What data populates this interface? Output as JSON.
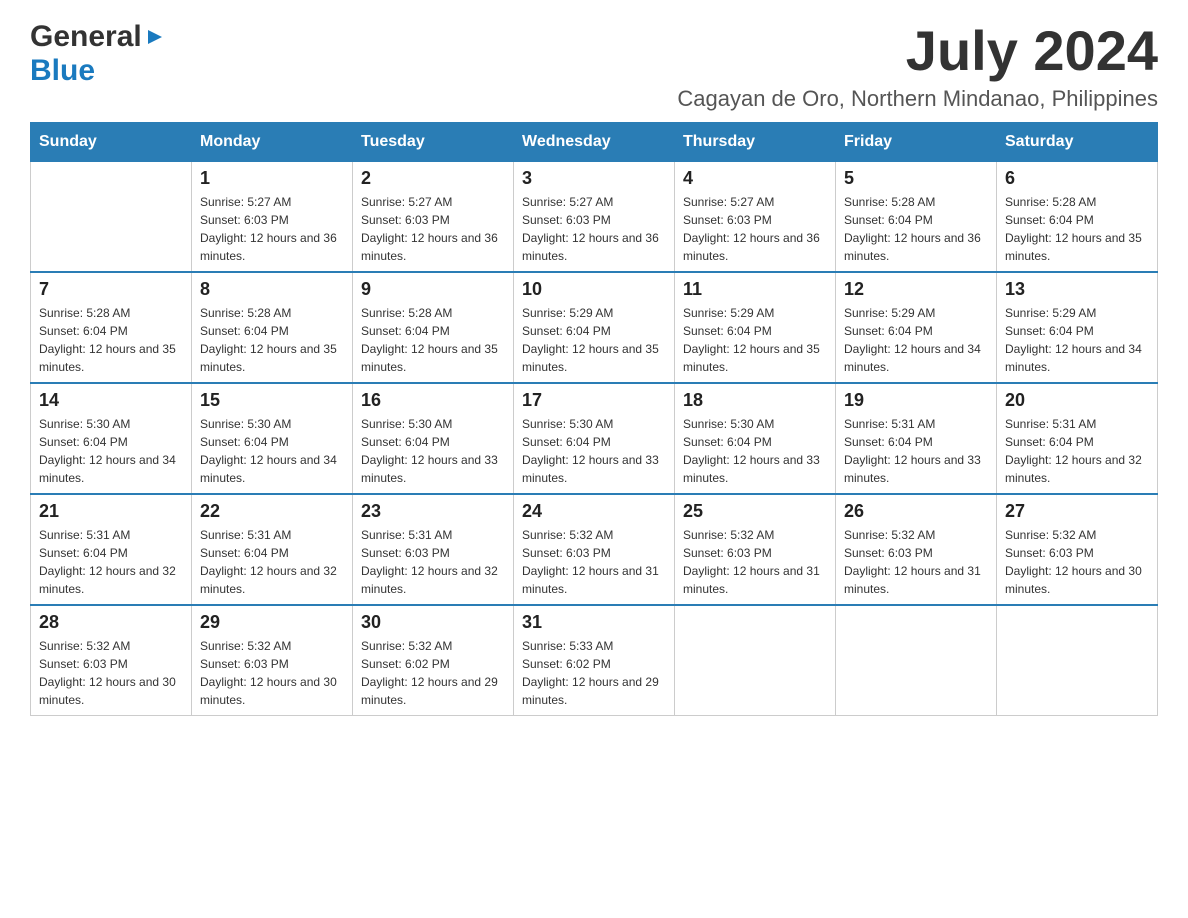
{
  "header": {
    "logo_general": "General",
    "logo_blue": "Blue",
    "month_title": "July 2024",
    "location": "Cagayan de Oro, Northern Mindanao, Philippines"
  },
  "days_of_week": [
    "Sunday",
    "Monday",
    "Tuesday",
    "Wednesday",
    "Thursday",
    "Friday",
    "Saturday"
  ],
  "weeks": [
    [
      {
        "day": "",
        "sunrise": "",
        "sunset": "",
        "daylight": ""
      },
      {
        "day": "1",
        "sunrise": "Sunrise: 5:27 AM",
        "sunset": "Sunset: 6:03 PM",
        "daylight": "Daylight: 12 hours and 36 minutes."
      },
      {
        "day": "2",
        "sunrise": "Sunrise: 5:27 AM",
        "sunset": "Sunset: 6:03 PM",
        "daylight": "Daylight: 12 hours and 36 minutes."
      },
      {
        "day": "3",
        "sunrise": "Sunrise: 5:27 AM",
        "sunset": "Sunset: 6:03 PM",
        "daylight": "Daylight: 12 hours and 36 minutes."
      },
      {
        "day": "4",
        "sunrise": "Sunrise: 5:27 AM",
        "sunset": "Sunset: 6:03 PM",
        "daylight": "Daylight: 12 hours and 36 minutes."
      },
      {
        "day": "5",
        "sunrise": "Sunrise: 5:28 AM",
        "sunset": "Sunset: 6:04 PM",
        "daylight": "Daylight: 12 hours and 36 minutes."
      },
      {
        "day": "6",
        "sunrise": "Sunrise: 5:28 AM",
        "sunset": "Sunset: 6:04 PM",
        "daylight": "Daylight: 12 hours and 35 minutes."
      }
    ],
    [
      {
        "day": "7",
        "sunrise": "Sunrise: 5:28 AM",
        "sunset": "Sunset: 6:04 PM",
        "daylight": "Daylight: 12 hours and 35 minutes."
      },
      {
        "day": "8",
        "sunrise": "Sunrise: 5:28 AM",
        "sunset": "Sunset: 6:04 PM",
        "daylight": "Daylight: 12 hours and 35 minutes."
      },
      {
        "day": "9",
        "sunrise": "Sunrise: 5:28 AM",
        "sunset": "Sunset: 6:04 PM",
        "daylight": "Daylight: 12 hours and 35 minutes."
      },
      {
        "day": "10",
        "sunrise": "Sunrise: 5:29 AM",
        "sunset": "Sunset: 6:04 PM",
        "daylight": "Daylight: 12 hours and 35 minutes."
      },
      {
        "day": "11",
        "sunrise": "Sunrise: 5:29 AM",
        "sunset": "Sunset: 6:04 PM",
        "daylight": "Daylight: 12 hours and 35 minutes."
      },
      {
        "day": "12",
        "sunrise": "Sunrise: 5:29 AM",
        "sunset": "Sunset: 6:04 PM",
        "daylight": "Daylight: 12 hours and 34 minutes."
      },
      {
        "day": "13",
        "sunrise": "Sunrise: 5:29 AM",
        "sunset": "Sunset: 6:04 PM",
        "daylight": "Daylight: 12 hours and 34 minutes."
      }
    ],
    [
      {
        "day": "14",
        "sunrise": "Sunrise: 5:30 AM",
        "sunset": "Sunset: 6:04 PM",
        "daylight": "Daylight: 12 hours and 34 minutes."
      },
      {
        "day": "15",
        "sunrise": "Sunrise: 5:30 AM",
        "sunset": "Sunset: 6:04 PM",
        "daylight": "Daylight: 12 hours and 34 minutes."
      },
      {
        "day": "16",
        "sunrise": "Sunrise: 5:30 AM",
        "sunset": "Sunset: 6:04 PM",
        "daylight": "Daylight: 12 hours and 33 minutes."
      },
      {
        "day": "17",
        "sunrise": "Sunrise: 5:30 AM",
        "sunset": "Sunset: 6:04 PM",
        "daylight": "Daylight: 12 hours and 33 minutes."
      },
      {
        "day": "18",
        "sunrise": "Sunrise: 5:30 AM",
        "sunset": "Sunset: 6:04 PM",
        "daylight": "Daylight: 12 hours and 33 minutes."
      },
      {
        "day": "19",
        "sunrise": "Sunrise: 5:31 AM",
        "sunset": "Sunset: 6:04 PM",
        "daylight": "Daylight: 12 hours and 33 minutes."
      },
      {
        "day": "20",
        "sunrise": "Sunrise: 5:31 AM",
        "sunset": "Sunset: 6:04 PM",
        "daylight": "Daylight: 12 hours and 32 minutes."
      }
    ],
    [
      {
        "day": "21",
        "sunrise": "Sunrise: 5:31 AM",
        "sunset": "Sunset: 6:04 PM",
        "daylight": "Daylight: 12 hours and 32 minutes."
      },
      {
        "day": "22",
        "sunrise": "Sunrise: 5:31 AM",
        "sunset": "Sunset: 6:04 PM",
        "daylight": "Daylight: 12 hours and 32 minutes."
      },
      {
        "day": "23",
        "sunrise": "Sunrise: 5:31 AM",
        "sunset": "Sunset: 6:03 PM",
        "daylight": "Daylight: 12 hours and 32 minutes."
      },
      {
        "day": "24",
        "sunrise": "Sunrise: 5:32 AM",
        "sunset": "Sunset: 6:03 PM",
        "daylight": "Daylight: 12 hours and 31 minutes."
      },
      {
        "day": "25",
        "sunrise": "Sunrise: 5:32 AM",
        "sunset": "Sunset: 6:03 PM",
        "daylight": "Daylight: 12 hours and 31 minutes."
      },
      {
        "day": "26",
        "sunrise": "Sunrise: 5:32 AM",
        "sunset": "Sunset: 6:03 PM",
        "daylight": "Daylight: 12 hours and 31 minutes."
      },
      {
        "day": "27",
        "sunrise": "Sunrise: 5:32 AM",
        "sunset": "Sunset: 6:03 PM",
        "daylight": "Daylight: 12 hours and 30 minutes."
      }
    ],
    [
      {
        "day": "28",
        "sunrise": "Sunrise: 5:32 AM",
        "sunset": "Sunset: 6:03 PM",
        "daylight": "Daylight: 12 hours and 30 minutes."
      },
      {
        "day": "29",
        "sunrise": "Sunrise: 5:32 AM",
        "sunset": "Sunset: 6:03 PM",
        "daylight": "Daylight: 12 hours and 30 minutes."
      },
      {
        "day": "30",
        "sunrise": "Sunrise: 5:32 AM",
        "sunset": "Sunset: 6:02 PM",
        "daylight": "Daylight: 12 hours and 29 minutes."
      },
      {
        "day": "31",
        "sunrise": "Sunrise: 5:33 AM",
        "sunset": "Sunset: 6:02 PM",
        "daylight": "Daylight: 12 hours and 29 minutes."
      },
      {
        "day": "",
        "sunrise": "",
        "sunset": "",
        "daylight": ""
      },
      {
        "day": "",
        "sunrise": "",
        "sunset": "",
        "daylight": ""
      },
      {
        "day": "",
        "sunrise": "",
        "sunset": "",
        "daylight": ""
      }
    ]
  ],
  "colors": {
    "header_bg": "#2a7db5",
    "header_text": "#ffffff",
    "border": "#cccccc",
    "day_text": "#222222",
    "info_text": "#333333"
  }
}
